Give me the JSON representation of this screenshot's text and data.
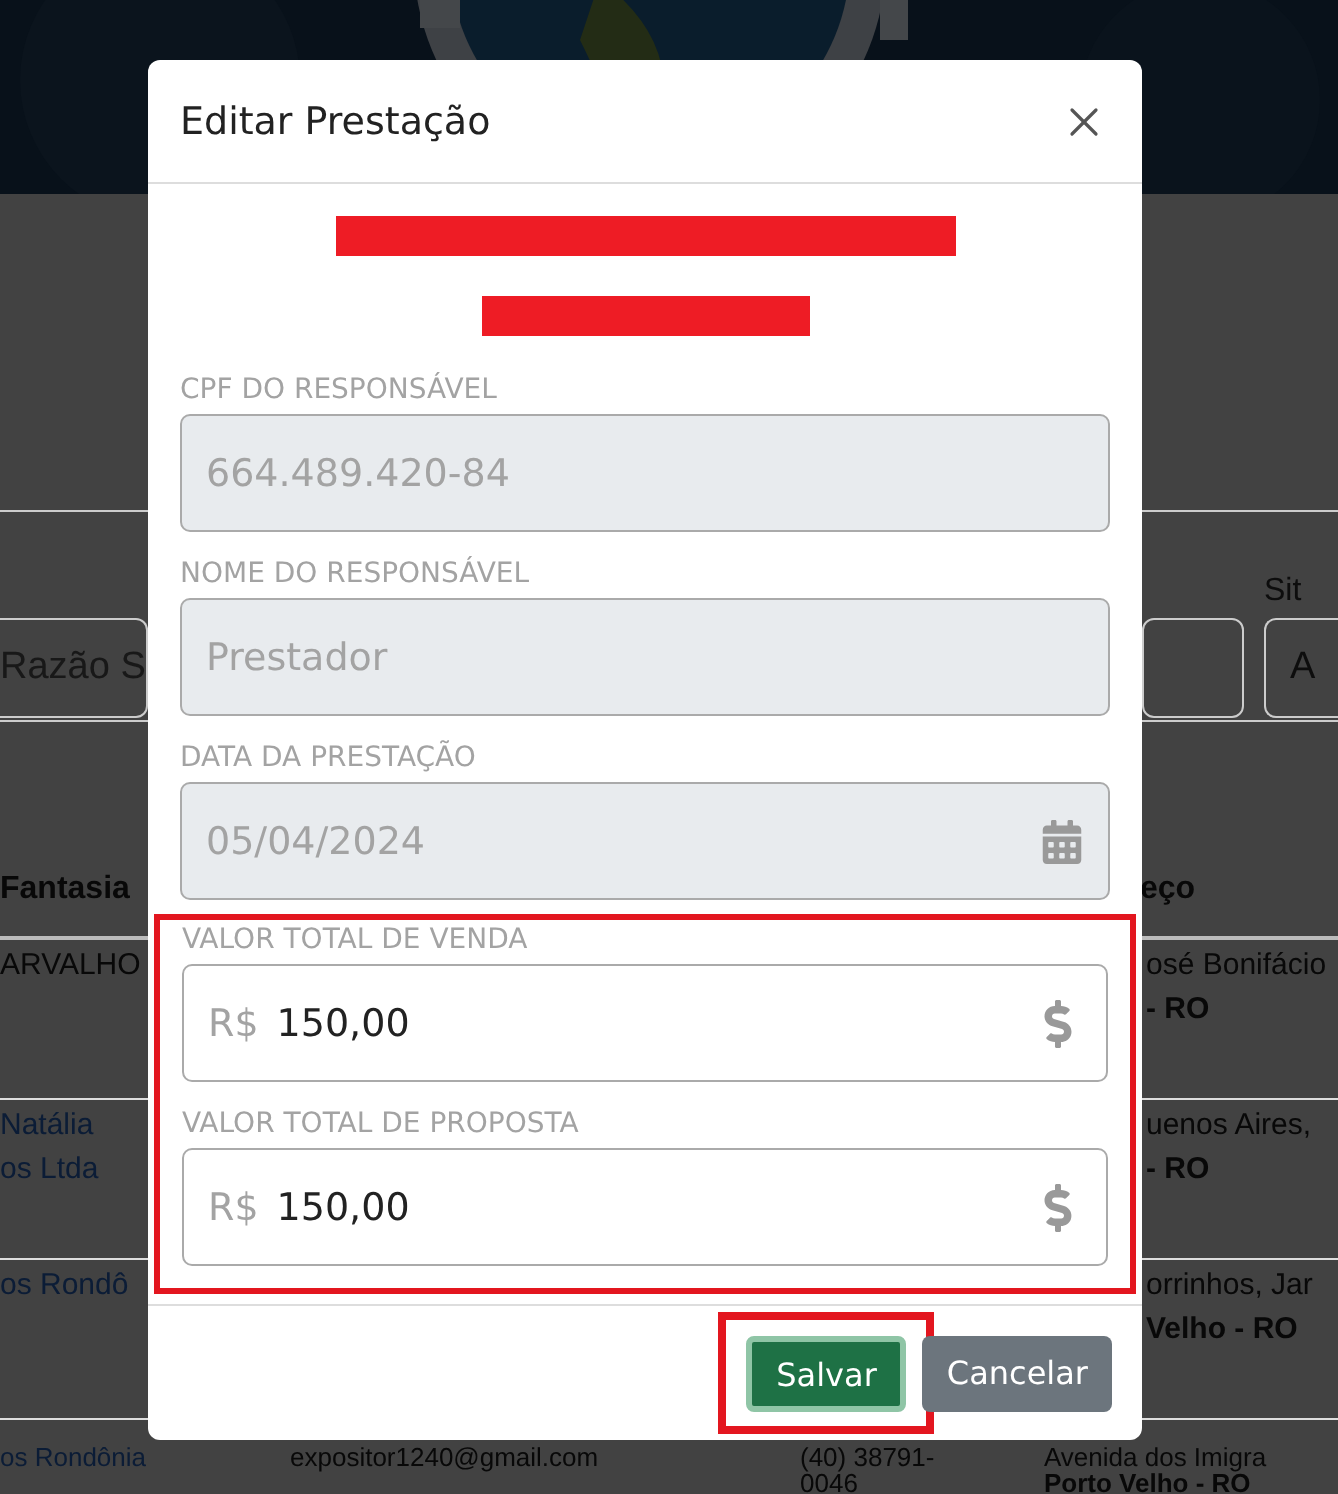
{
  "background_page": {
    "filters": {
      "search_placeholder": "Razão S",
      "status_label": "Sit",
      "status_value": "A"
    },
    "table": {
      "columns": [
        "Fantasia",
        "eço"
      ],
      "rows": [
        {
          "name": [
            "ARVALHO"
          ],
          "link": false,
          "email": "",
          "phone": [],
          "street": "osé Bonifácio",
          "city": "- RO",
          "cut": true
        },
        {
          "name": [
            "Natália",
            "os Ltda"
          ],
          "link": true,
          "email": "",
          "phone": [],
          "street": "uenos Aires,",
          "city": "- RO",
          "cut": true
        },
        {
          "name": [
            "os Rondô"
          ],
          "link": true,
          "email": "",
          "phone": [],
          "street": "orrinhos, Jar",
          "city": "Velho - RO",
          "cut": true
        },
        {
          "name": [
            "os Rondônia"
          ],
          "link": true,
          "email": "expositor1240@gmail.com",
          "phone": [
            "(40) 38791-",
            "0046"
          ],
          "street": "Avenida dos Imigra",
          "city": "Porto Velho - RO",
          "cut": false
        }
      ]
    }
  },
  "modal": {
    "title": "Editar Prestação",
    "redactions": [
      {
        "kind": "long"
      },
      {
        "kind": "short"
      }
    ],
    "groups": [
      {
        "highlighted": false,
        "fields": [
          {
            "kind": "text",
            "label": "CPF DO RESPONSÁVEL",
            "value": "664.489.420-84",
            "disabled": true
          },
          {
            "kind": "text",
            "label": "NOME DO RESPONSÁVEL",
            "value": "Prestador",
            "disabled": true
          },
          {
            "kind": "date",
            "label": "DATA DA PRESTAÇÃO",
            "value": "05/04/2024",
            "disabled": true
          }
        ]
      },
      {
        "highlighted": true,
        "fields": [
          {
            "kind": "currency",
            "label": "VALOR TOTAL DE VENDA",
            "prefix": "R$",
            "value": "150,00",
            "disabled": false
          },
          {
            "kind": "currency",
            "label": "VALOR TOTAL DE PROPOSTA",
            "prefix": "R$",
            "value": "150,00",
            "disabled": false
          }
        ]
      }
    ],
    "buttons": [
      {
        "label": "Salvar",
        "kind": "primary",
        "highlighted": true
      },
      {
        "label": "Cancelar",
        "kind": "secondary",
        "highlighted": false
      }
    ]
  }
}
